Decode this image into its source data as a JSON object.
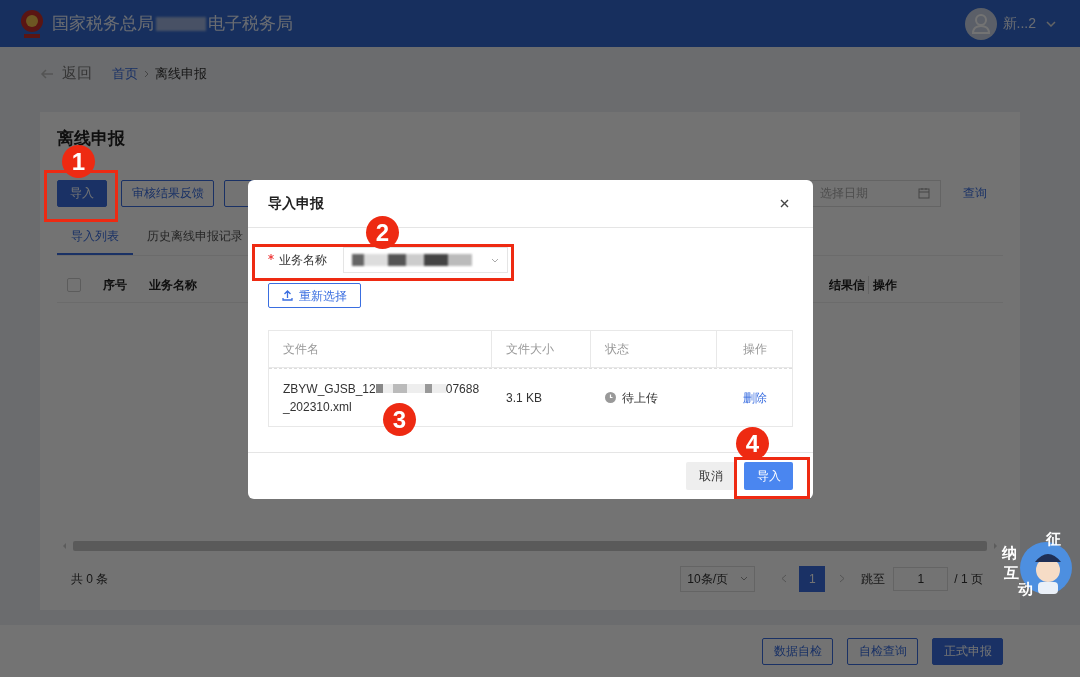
{
  "header": {
    "title_start": "国家税务总局",
    "title_end": "电子税务局",
    "user": "新...2"
  },
  "breadcrumb": {
    "back": "返回",
    "items": [
      "首页",
      "离线申报"
    ]
  },
  "page_title": "离线申报",
  "toolbar": {
    "buttons": [
      {
        "label": "导入",
        "kind": "primary"
      },
      {
        "label": "审核结果反馈",
        "kind": "outline"
      }
    ],
    "date_placeholder": "选择日期",
    "query": "查询"
  },
  "tabs": [
    {
      "label": "导入列表",
      "selected": true
    },
    {
      "label": "历史离线申报记录",
      "selected": false
    }
  ],
  "table": {
    "select_all_checked": false,
    "columns": [
      "序号",
      "业务名称",
      "结果信",
      "操作"
    ]
  },
  "pagination": {
    "total": "共 0 条",
    "page_size": "10条/页",
    "pages": [
      {
        "label": "1",
        "selected": true
      }
    ],
    "jump_label": "跳至",
    "jump_value": "1",
    "total_pages": "/ 1 页"
  },
  "bottom_buttons": [
    {
      "label": "数据自检",
      "kind": "outline"
    },
    {
      "label": "自检查询",
      "kind": "outline"
    },
    {
      "label": "正式申报",
      "kind": "primary"
    }
  ],
  "modal": {
    "title": "导入申报",
    "field": {
      "label": "业务名称",
      "required": true
    },
    "reselect": "重新选择",
    "columns": [
      "文件名",
      "文件大小",
      "状态",
      "操作"
    ],
    "files": [
      {
        "name_start": "ZBYW_GJSB_12",
        "name_mid": "07688",
        "name_end": "_202310.xml",
        "size": "3.1 KB",
        "status": "待上传",
        "action": "删除"
      }
    ],
    "buttons": [
      {
        "label": "取消",
        "kind": "default"
      },
      {
        "label": "导入",
        "kind": "primary"
      }
    ]
  },
  "annotations": [
    {
      "number": "1"
    },
    {
      "number": "2"
    },
    {
      "number": "3"
    },
    {
      "number": "4"
    }
  ],
  "assistant": {
    "chars": [
      "征",
      "纳",
      "互",
      "动"
    ]
  }
}
